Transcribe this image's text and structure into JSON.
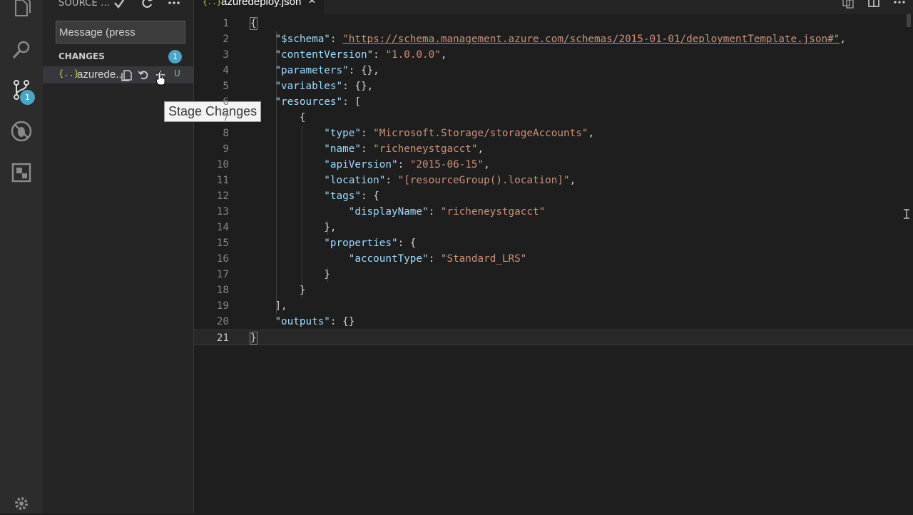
{
  "sidebar": {
    "title": "SOURCE ...",
    "message_placeholder": "Message (press",
    "changes_label": "CHANGES",
    "changes_count": "1",
    "file": {
      "icon": "{..}",
      "name": "azurede..",
      "status": "U"
    },
    "tooltip": "Stage Changes"
  },
  "activity": {
    "scm_badge": "1"
  },
  "editor": {
    "tab": {
      "icon": "{..}",
      "label": "azuredeploy.json",
      "close": "✕"
    },
    "line_numbers": [
      "1",
      "2",
      "3",
      "4",
      "5",
      "6",
      "7",
      "8",
      "9",
      "10",
      "11",
      "12",
      "13",
      "14",
      "15",
      "16",
      "17",
      "18",
      "19",
      "20",
      "21"
    ],
    "code": {
      "l1": "{",
      "l2_key": "\"$schema\"",
      "l2_sep": ": ",
      "l2_val": "\"https://schema.management.azure.com/schemas/2015-01-01/deploymentTemplate.json#\"",
      "l2_end": ",",
      "l3_key": "\"contentVersion\"",
      "l3_val": "\"1.0.0.0\"",
      "l4_key": "\"parameters\"",
      "l4_rest": ": {},",
      "l5_key": "\"variables\"",
      "l5_rest": ": {},",
      "l6_key": "\"resources\"",
      "l6_rest": ": [",
      "l7": "{",
      "l8_key": "\"type\"",
      "l8_val": "\"Microsoft.Storage/storageAccounts\"",
      "l9_key": "\"name\"",
      "l9_val": "\"richeneystgacct\"",
      "l10_key": "\"apiVersion\"",
      "l10_val": "\"2015-06-15\"",
      "l11_key": "\"location\"",
      "l11_val": "\"[resourceGroup().location]\"",
      "l12_key": "\"tags\"",
      "l12_rest": ": {",
      "l13_key": "\"displayName\"",
      "l13_val": "\"richeneystgacct\"",
      "l14": "},",
      "l15_key": "\"properties\"",
      "l15_rest": ": {",
      "l16_key": "\"accountType\"",
      "l16_val": "\"Standard_LRS\"",
      "l17": "}",
      "l18": "}",
      "l19": "],",
      "l20_key": "\"outputs\"",
      "l20_rest": ": {}",
      "l21": "}"
    }
  },
  "colors": {
    "accent": "#49a6c9",
    "untracked": "#73c991",
    "json_icon": "#cbcb41"
  }
}
